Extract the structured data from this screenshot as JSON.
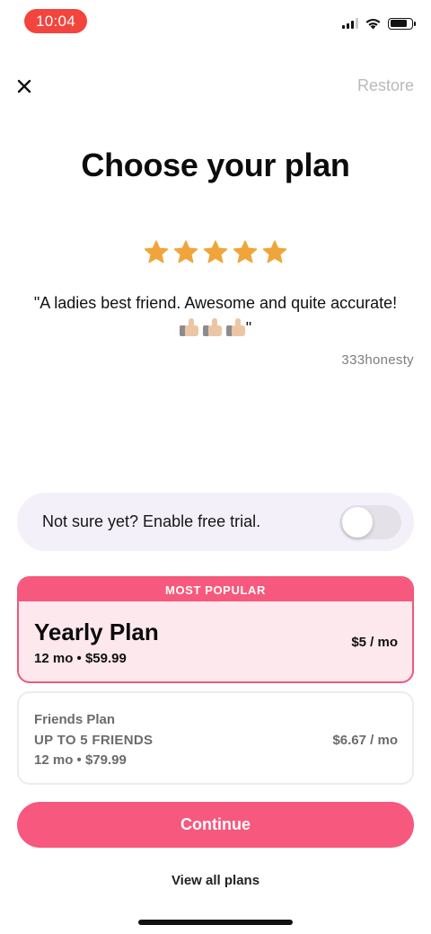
{
  "status_bar": {
    "time": "10:04",
    "icons": [
      "cellular-signal-icon",
      "wifi-icon",
      "battery-icon"
    ]
  },
  "nav": {
    "close_icon": "close-icon",
    "restore_label": "Restore"
  },
  "title": "Choose your plan",
  "review": {
    "stars": 5,
    "star_color": "#f0a53b",
    "quote_text": "\"A ladies best friend. Awesome and quite accurate!",
    "quote_emoji": "thumbs-up-icon ×3",
    "quote_end": "\"",
    "author": "333honesty"
  },
  "trial": {
    "label": "Not sure yet? Enable free trial.",
    "enabled": false
  },
  "plans": [
    {
      "badge": "MOST POPULAR",
      "name": "Yearly Plan",
      "subtitle": "12 mo • $59.99",
      "price": "$5 / mo",
      "selected": true
    },
    {
      "name": "Friends Plan",
      "detail": "UP TO 5 FRIENDS",
      "subtitle": "12 mo • $79.99",
      "price": "$6.67 / mo",
      "selected": false
    }
  ],
  "continue_label": "Continue",
  "view_all_label": "View all plans",
  "colors": {
    "accent": "#f7587d",
    "status_pill": "#f2453d",
    "popular_bg": "#fde8ee",
    "trial_bg": "#f3f0fa"
  }
}
